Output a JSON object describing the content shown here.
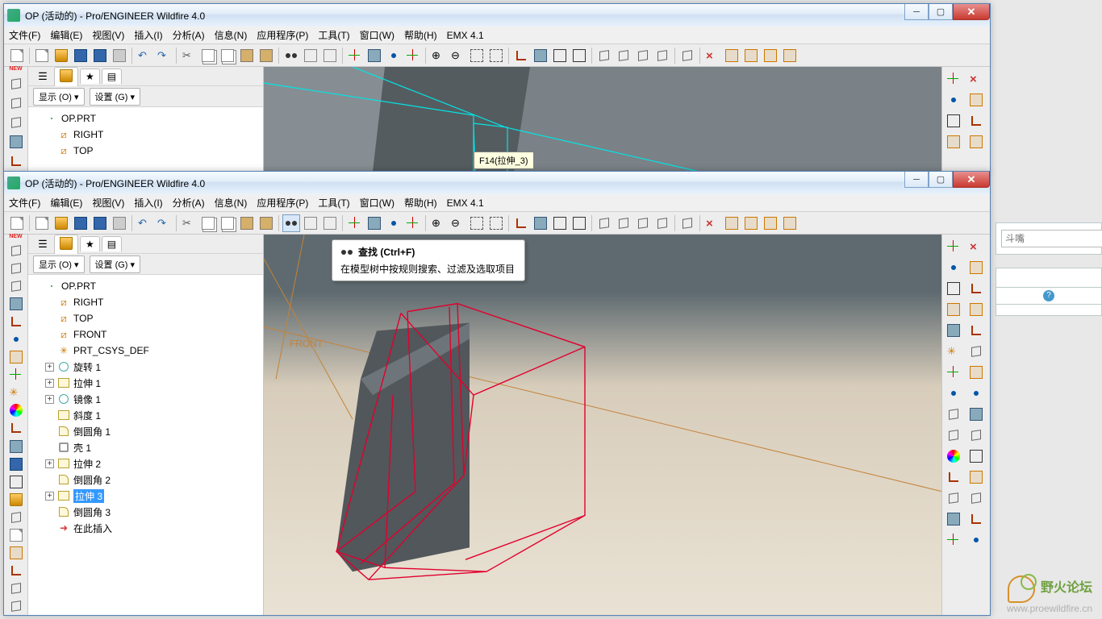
{
  "app_title": "OP (活动的) - Pro/ENGINEER Wildfire 4.0",
  "menus": [
    "文件(F)",
    "编辑(E)",
    "视图(V)",
    "插入(I)",
    "分析(A)",
    "信息(N)",
    "应用程序(P)",
    "工具(T)",
    "窗口(W)",
    "帮助(H)",
    "EMX 4.1"
  ],
  "tree_bar": {
    "show": "显示 (O) ▾",
    "settings": "设置 (G) ▾"
  },
  "win1": {
    "hint": "F14(拉伸_3)",
    "tree": [
      {
        "icon": "t-part",
        "label": "OP.PRT",
        "indent": 0
      },
      {
        "icon": "t-datum",
        "label": "RIGHT",
        "indent": 1,
        "glyph": "⧄"
      },
      {
        "icon": "t-datum",
        "label": "TOP",
        "indent": 1,
        "glyph": "⧄"
      }
    ]
  },
  "win2": {
    "tooltip_title": "查找 (Ctrl+F)",
    "tooltip_body": "在模型树中按规则搜索、过滤及选取项目",
    "viewport_label": "FRONT",
    "tree": [
      {
        "icon": "t-part",
        "label": "OP.PRT",
        "indent": 0
      },
      {
        "icon": "t-datum",
        "label": "RIGHT",
        "indent": 1,
        "glyph": "⧄"
      },
      {
        "icon": "t-datum",
        "label": "TOP",
        "indent": 1,
        "glyph": "⧄"
      },
      {
        "icon": "t-datum",
        "label": "FRONT",
        "indent": 1,
        "glyph": "⧄"
      },
      {
        "icon": "t-csys",
        "label": "PRT_CSYS_DEF",
        "indent": 1,
        "glyph": "✳"
      },
      {
        "icon": "t-feat2",
        "label": "旋转 1",
        "indent": 1,
        "exp": "+"
      },
      {
        "icon": "t-feat",
        "label": "拉伸 1",
        "indent": 1,
        "exp": "+"
      },
      {
        "icon": "t-feat2",
        "label": "镜像 1",
        "indent": 1,
        "exp": "+"
      },
      {
        "icon": "t-feat",
        "label": "斜度 1",
        "indent": 1
      },
      {
        "icon": "t-round",
        "label": "倒圆角 1",
        "indent": 1
      },
      {
        "icon": "t-shell",
        "label": "壳 1",
        "indent": 1
      },
      {
        "icon": "t-feat",
        "label": "拉伸 2",
        "indent": 1,
        "exp": "+"
      },
      {
        "icon": "t-round",
        "label": "倒圆角 2",
        "indent": 1
      },
      {
        "icon": "t-feat",
        "label": "拉伸 3",
        "indent": 1,
        "exp": "+",
        "sel": true
      },
      {
        "icon": "t-round",
        "label": "倒圆角 3",
        "indent": 1
      },
      {
        "icon": "t-arrow",
        "label": "在此插入",
        "indent": 1,
        "glyph": "➜"
      }
    ]
  },
  "right_fragment": {
    "search_placeholder": "斗嘴"
  },
  "watermark": {
    "name": "野火论坛",
    "url": "www.proewildfire.cn"
  }
}
